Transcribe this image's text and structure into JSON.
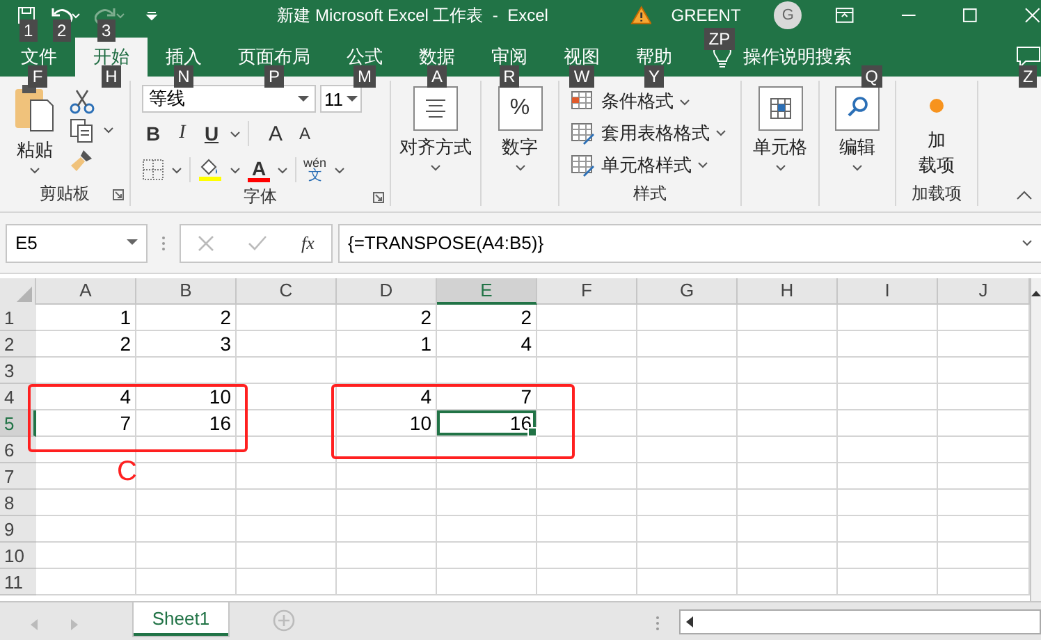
{
  "title_bar": {
    "quick_access": [
      {
        "kind": "save",
        "keytip": "1",
        "disabled": false
      },
      {
        "kind": "undo",
        "keytip": "2",
        "disabled": false
      },
      {
        "kind": "redo",
        "keytip": "3",
        "disabled": true
      }
    ],
    "title": "新建 Microsoft Excel 工作表  -  Excel",
    "user": "GREENT",
    "user_keytip": "ZP",
    "avatar": "G"
  },
  "tabs": [
    {
      "label": "文件",
      "keytip": "F",
      "selected": false
    },
    {
      "label": "开始",
      "keytip": "H",
      "selected": true
    },
    {
      "label": "插入",
      "keytip": "N",
      "selected": false
    },
    {
      "label": "页面布局",
      "keytip": "P",
      "selected": false
    },
    {
      "label": "公式",
      "keytip": "M",
      "selected": false
    },
    {
      "label": "数据",
      "keytip": "A",
      "selected": false
    },
    {
      "label": "审阅",
      "keytip": "R",
      "selected": false
    },
    {
      "label": "视图",
      "keytip": "W",
      "selected": false
    },
    {
      "label": "帮助",
      "keytip": "Y",
      "selected": false
    }
  ],
  "tell_me": {
    "label": "操作说明搜索",
    "keytip": "Q"
  },
  "comments_keytip": "Z",
  "ribbon": {
    "clipboard": {
      "paste": "粘贴",
      "label": "剪贴板"
    },
    "font": {
      "name": "等线",
      "size": "11",
      "bold": "B",
      "italic": "I",
      "underline": "U",
      "grow": "A",
      "shrink": "A",
      "font_color": "A",
      "phonetic_top": "wén",
      "phonetic_bottom": "文",
      "label": "字体"
    },
    "alignment": {
      "label": "对齐方式"
    },
    "number": {
      "symbol": "%",
      "label": "数字"
    },
    "styles": {
      "items": [
        "条件格式",
        "套用表格格式",
        "单元格样式"
      ],
      "label": "样式"
    },
    "cells": {
      "label": "单元格"
    },
    "editing": {
      "label": "编辑"
    },
    "addins": {
      "button": [
        "加",
        "载项"
      ],
      "label": "加载项"
    }
  },
  "formula_bar": {
    "name_box": "E5",
    "fx": "fx",
    "formula": "{=TRANSPOSE(A4:B5)}"
  },
  "grid": {
    "columns": [
      {
        "label": "A",
        "selected": false
      },
      {
        "label": "B",
        "selected": false
      },
      {
        "label": "C",
        "selected": false
      },
      {
        "label": "D",
        "selected": false
      },
      {
        "label": "E",
        "selected": true
      },
      {
        "label": "F",
        "selected": false
      },
      {
        "label": "G",
        "selected": false
      },
      {
        "label": "H",
        "selected": false
      },
      {
        "label": "I",
        "selected": false
      },
      {
        "label": "J",
        "selected": false
      }
    ],
    "rows": [
      {
        "label": "1",
        "selected": false,
        "cells": [
          "1",
          "2",
          null,
          "2",
          "2",
          null,
          null,
          null,
          null,
          null
        ]
      },
      {
        "label": "2",
        "selected": false,
        "cells": [
          "2",
          "3",
          null,
          "1",
          "4",
          null,
          null,
          null,
          null,
          null
        ]
      },
      {
        "label": "3",
        "selected": false,
        "cells": [
          null,
          null,
          null,
          null,
          null,
          null,
          null,
          null,
          null,
          null
        ]
      },
      {
        "label": "4",
        "selected": false,
        "cells": [
          "4",
          "10",
          null,
          "4",
          "7",
          null,
          null,
          null,
          null,
          null
        ]
      },
      {
        "label": "5",
        "selected": true,
        "cells": [
          "7",
          "16",
          null,
          "10",
          "16",
          null,
          null,
          null,
          null,
          null
        ]
      },
      {
        "label": "6",
        "selected": false,
        "cells": [
          null,
          null,
          null,
          null,
          null,
          null,
          null,
          null,
          null,
          null
        ]
      },
      {
        "label": "7",
        "selected": false,
        "cells": [
          null,
          null,
          null,
          null,
          null,
          null,
          null,
          null,
          null,
          null
        ]
      },
      {
        "label": "8",
        "selected": false,
        "cells": [
          null,
          null,
          null,
          null,
          null,
          null,
          null,
          null,
          null,
          null
        ]
      },
      {
        "label": "9",
        "selected": false,
        "cells": [
          null,
          null,
          null,
          null,
          null,
          null,
          null,
          null,
          null,
          null
        ]
      },
      {
        "label": "10",
        "selected": false,
        "cells": [
          null,
          null,
          null,
          null,
          null,
          null,
          null,
          null,
          null,
          null
        ]
      },
      {
        "label": "11",
        "selected": false,
        "cells": [
          null,
          null,
          null,
          null,
          null,
          null,
          null,
          null,
          null,
          null
        ]
      }
    ],
    "annotation_note": "C"
  },
  "sheets": [
    {
      "label": "Sheet1",
      "selected": true
    }
  ]
}
